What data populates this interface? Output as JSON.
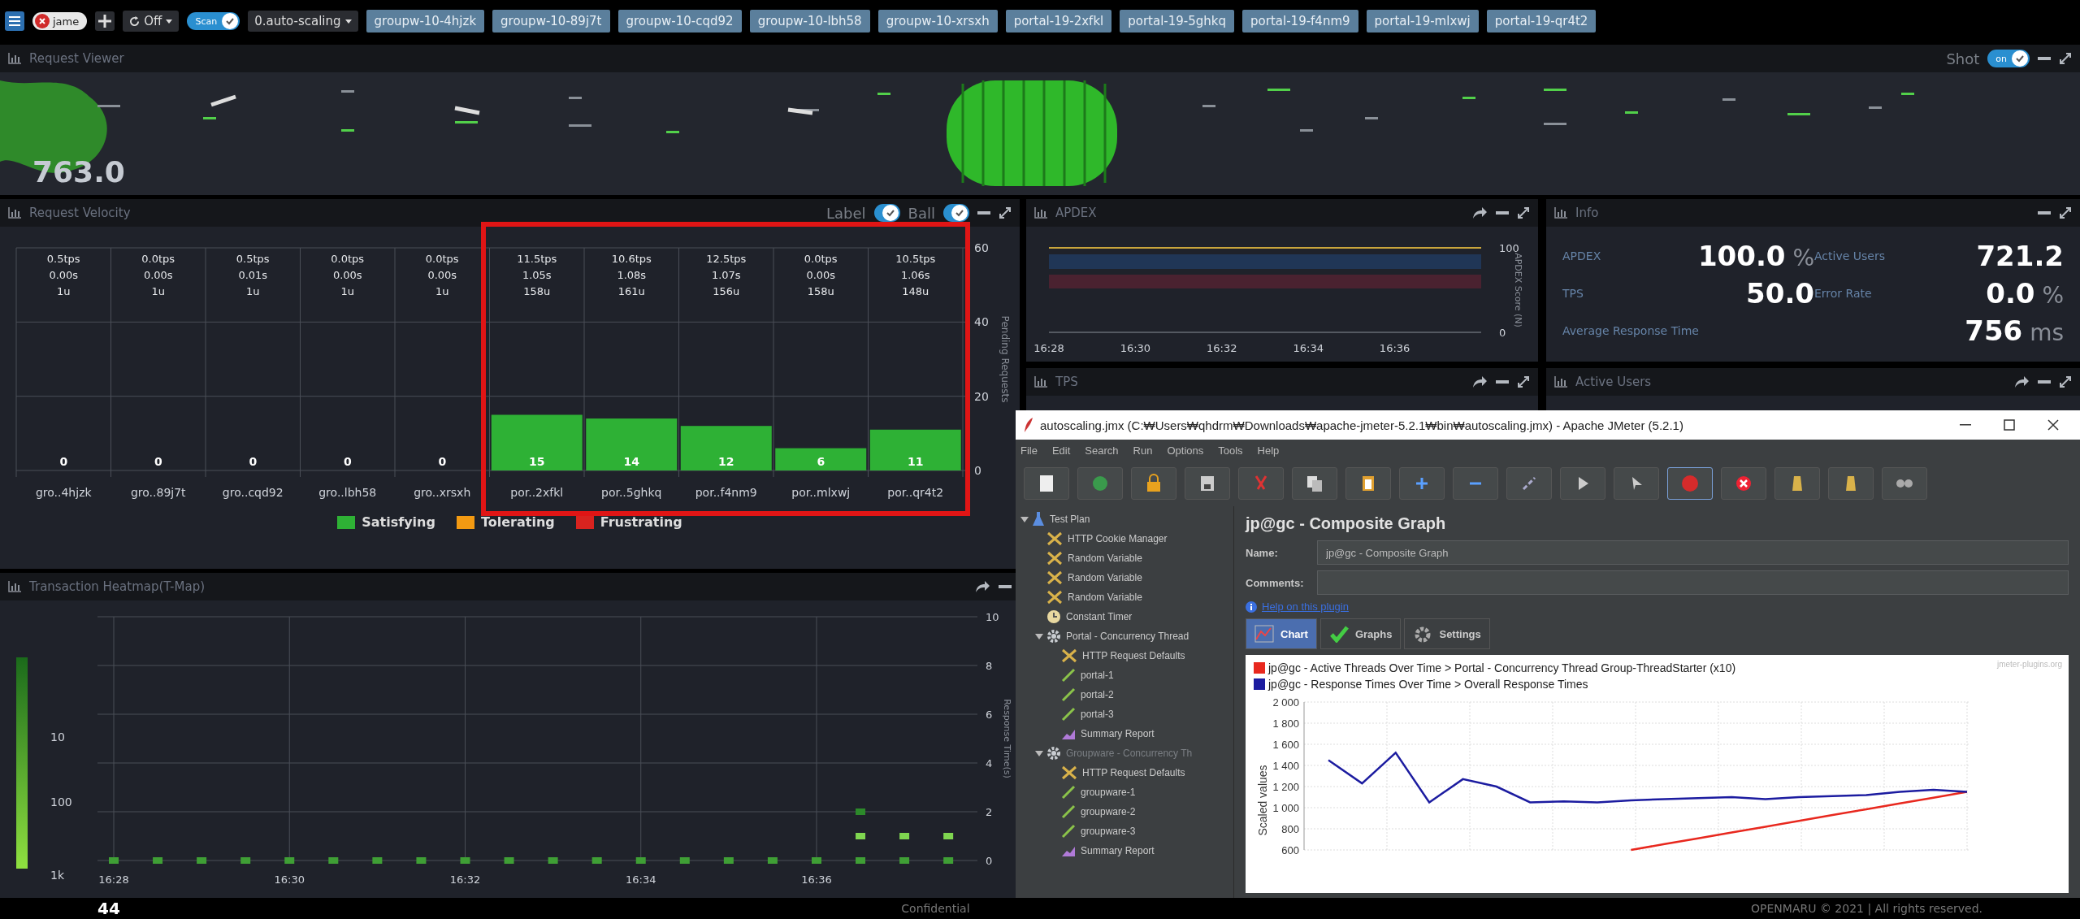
{
  "top_bar": {
    "user": "jame",
    "refresh": "Off",
    "scan_toggle": {
      "label": "Scan",
      "on": true
    },
    "scaling_group": "0.auto-scaling",
    "instances": [
      "groupw-10-4hjzk",
      "groupw-10-89j7t",
      "groupw-10-cqd92",
      "groupw-10-lbh58",
      "groupw-10-xrsxh",
      "portal-19-2xfkl",
      "portal-19-5ghkq",
      "portal-19-f4nm9",
      "portal-19-mlxwj",
      "portal-19-qr4t2"
    ]
  },
  "request_viewer": {
    "title": "Request Viewer",
    "shot_label": "Shot",
    "shot_toggle": {
      "label": "on",
      "on": true
    },
    "total": "763.0"
  },
  "request_velocity": {
    "title": "Request Velocity",
    "label_toggle": {
      "label": "Label",
      "on": true
    },
    "ball_toggle": {
      "label": "Ball",
      "on": true
    },
    "columns": [
      {
        "tps": "0.5tps",
        "time": "0.00s",
        "users": "1u"
      },
      {
        "tps": "0.0tps",
        "time": "0.00s",
        "users": "1u"
      },
      {
        "tps": "0.5tps",
        "time": "0.01s",
        "users": "1u"
      },
      {
        "tps": "0.0tps",
        "time": "0.00s",
        "users": "1u"
      },
      {
        "tps": "0.0tps",
        "time": "0.00s",
        "users": "1u"
      },
      {
        "tps": "11.5tps",
        "time": "1.05s",
        "users": "158u"
      },
      {
        "tps": "10.6tps",
        "time": "1.08s",
        "users": "161u"
      },
      {
        "tps": "12.5tps",
        "time": "1.07s",
        "users": "156u"
      },
      {
        "tps": "0.0tps",
        "time": "0.00s",
        "users": "158u"
      },
      {
        "tps": "10.5tps",
        "time": "1.06s",
        "users": "148u"
      }
    ],
    "chart_data": {
      "type": "bar",
      "ylabel": "Pending Requests",
      "categories": [
        "gro..4hjzk",
        "gro..89j7t",
        "gro..cqd92",
        "gro..lbh58",
        "gro..xrsxh",
        "por..2xfkl",
        "por..5ghkq",
        "por..f4nm9",
        "por..mlxwj",
        "por..qr4t2"
      ],
      "ylim": [
        0,
        60
      ],
      "yticks": [
        0,
        20,
        40,
        60
      ],
      "data_labels": true,
      "series": [
        {
          "name": "Satisfying",
          "color": "#2eb135",
          "values": [
            0,
            0,
            0,
            0,
            0,
            15,
            14,
            12,
            6,
            11
          ]
        }
      ]
    },
    "legend": [
      {
        "label": "Tolerating",
        "color": "#f39a12"
      },
      {
        "label": "Frustrating",
        "color": "#d8231f"
      }
    ]
  },
  "apdex": {
    "title": "APDEX",
    "chart_data": {
      "type": "line",
      "ylabel": "APDEX Score (N)",
      "categories": [
        "16:28",
        "16:30",
        "16:32",
        "16:34",
        "16:36",
        null
      ],
      "ylim": [
        0,
        100
      ],
      "yticks": [
        0,
        100
      ],
      "series": [
        {
          "color": "#c9a63c",
          "values": [
            100,
            100,
            100,
            100,
            100,
            100
          ]
        }
      ]
    }
  },
  "info": {
    "title": "Info",
    "metrics": [
      {
        "label": "APDEX",
        "value": "100.0",
        "unit": "%"
      },
      {
        "label": "Active Users",
        "value": "721.2"
      },
      {
        "label": "TPS",
        "value": "50.0"
      },
      {
        "label": "Error Rate",
        "value": "0.0",
        "unit": "%"
      },
      {
        "label": "Average Response Time",
        "value": "756",
        "unit": "ms"
      }
    ]
  },
  "tps": {
    "title": "TPS"
  },
  "active_users": {
    "title": "Active Users"
  },
  "heatmap": {
    "title": "Transaction Heatmap(T-Map)",
    "scale_labels": [
      "10",
      "100",
      "1k"
    ],
    "chart_data": {
      "type": "scatter",
      "ylabel": "Response Time(s)",
      "categories": [
        "16:28",
        null,
        null,
        null,
        "16:30",
        null,
        null,
        null,
        "16:32",
        null,
        null,
        null,
        "16:34",
        null,
        null,
        null,
        "16:36",
        null,
        null,
        null
      ],
      "ylim": [
        0,
        10
      ],
      "yticks": [
        0,
        2,
        4,
        6,
        8,
        10
      ],
      "grid": true,
      "series": [
        {
          "color": "#3f9f35",
          "values": [
            0,
            0,
            0,
            0,
            0,
            0,
            0,
            0,
            0,
            0,
            0,
            0,
            0,
            0,
            0,
            0,
            0,
            0,
            0,
            0
          ]
        },
        {
          "color": "#7fd650",
          "values": [
            null,
            null,
            null,
            null,
            null,
            null,
            null,
            null,
            null,
            null,
            null,
            null,
            null,
            null,
            null,
            null,
            null,
            1,
            1,
            1
          ]
        },
        {
          "color": "#2c8a2a",
          "values": [
            null,
            null,
            null,
            null,
            null,
            null,
            null,
            null,
            null,
            null,
            null,
            null,
            null,
            null,
            null,
            null,
            null,
            2,
            null,
            null
          ]
        }
      ]
    }
  },
  "jmeter": {
    "title": "autoscaling.jmx (C:₩Users₩qhdrm₩Downloads₩apache-jmeter-5.2.1₩bin₩autoscaling.jmx) - Apache JMeter (5.2.1)",
    "menu": [
      "File",
      "Edit",
      "Search",
      "Run",
      "Options",
      "Tools",
      "Help"
    ],
    "tree": [
      {
        "label": "Test Plan",
        "kind": "plan",
        "disabled": false,
        "expanded": true,
        "children": [
          {
            "label": "HTTP Cookie Manager",
            "kind": "config",
            "disabled": false
          },
          {
            "label": "Random Variable",
            "kind": "config",
            "disabled": false
          },
          {
            "label": "Random Variable",
            "kind": "config",
            "disabled": false
          },
          {
            "label": "Random Variable",
            "kind": "config",
            "disabled": false
          },
          {
            "label": "Constant Timer",
            "kind": "timer",
            "disabled": false
          },
          {
            "label": "Portal - Concurrency Thread",
            "kind": "thread_group",
            "disabled": false,
            "expanded": true,
            "children": [
              {
                "label": "HTTP Request Defaults",
                "kind": "config",
                "disabled": false
              },
              {
                "label": "portal-1",
                "kind": "sampler",
                "disabled": false
              },
              {
                "label": "portal-2",
                "kind": "sampler",
                "disabled": false
              },
              {
                "label": "portal-3",
                "kind": "sampler",
                "disabled": false
              },
              {
                "label": "Summary Report",
                "kind": "listener",
                "disabled": false
              }
            ]
          },
          {
            "label": "Groupware - Concurrency Th",
            "kind": "thread_group",
            "disabled": true,
            "expanded": true,
            "children": [
              {
                "label": "HTTP Request Defaults",
                "kind": "config",
                "disabled": false
              },
              {
                "label": "groupware-1",
                "kind": "sampler",
                "disabled": false
              },
              {
                "label": "groupware-2",
                "kind": "sampler",
                "disabled": false
              },
              {
                "label": "groupware-3",
                "kind": "sampler",
                "disabled": false
              },
              {
                "label": "Summary Report",
                "kind": "listener",
                "disabled": false
              }
            ]
          }
        ]
      }
    ],
    "heading": "jp@gc - Composite Graph",
    "name_label": "Name:",
    "name_value": "jp@gc - Composite Graph",
    "comments_label": "Comments:",
    "help_link": "Help on this plugin",
    "tabs": [
      {
        "label": "Chart",
        "selected": true
      },
      {
        "label": "Graphs",
        "selected": false
      },
      {
        "label": "Settings",
        "selected": false
      }
    ],
    "chart": {
      "credit": "jmeter-plugins.org",
      "chart_data": {
        "type": "line",
        "ylabel": "Scaled values",
        "grid": true,
        "ylim": [
          600,
          2000
        ],
        "yticks": [
          {
            "value": 600,
            "label": "600"
          },
          {
            "value": 800,
            "label": "800"
          },
          {
            "value": 1000,
            "label": "1 000"
          },
          {
            "value": 1200,
            "label": "1 200"
          },
          {
            "value": 1400,
            "label": "1 400"
          },
          {
            "value": 1600,
            "label": "1 600"
          },
          {
            "value": 1800,
            "label": "1 800"
          },
          {
            "value": 2000,
            "label": "2 000"
          }
        ],
        "series": [
          {
            "name": "jp@gc - Active Threads Over Time > Portal - Concurrency Thread Group-ThreadStarter (x10)",
            "color": "#e8281e",
            "values": [
              null,
              null,
              null,
              null,
              null,
              null,
              null,
              null,
              null,
              600,
              655,
              710,
              765,
              820,
              875,
              930,
              985,
              1040,
              1095,
              1150
            ]
          },
          {
            "name": "jp@gc - Response Times Over Time > Overall Response Times",
            "color": "#1c1ca0",
            "values": [
              1450,
              1230,
              1520,
              1050,
              1270,
              1200,
              1050,
              1060,
              1050,
              1070,
              1080,
              1090,
              1100,
              1080,
              1100,
              1110,
              1120,
              1150,
              1170,
              1150
            ]
          }
        ]
      }
    }
  },
  "footer": {
    "page_number": "44",
    "confidential": "Confidential",
    "copyright": "OPENMARU © 2021 | All rights reserved."
  }
}
